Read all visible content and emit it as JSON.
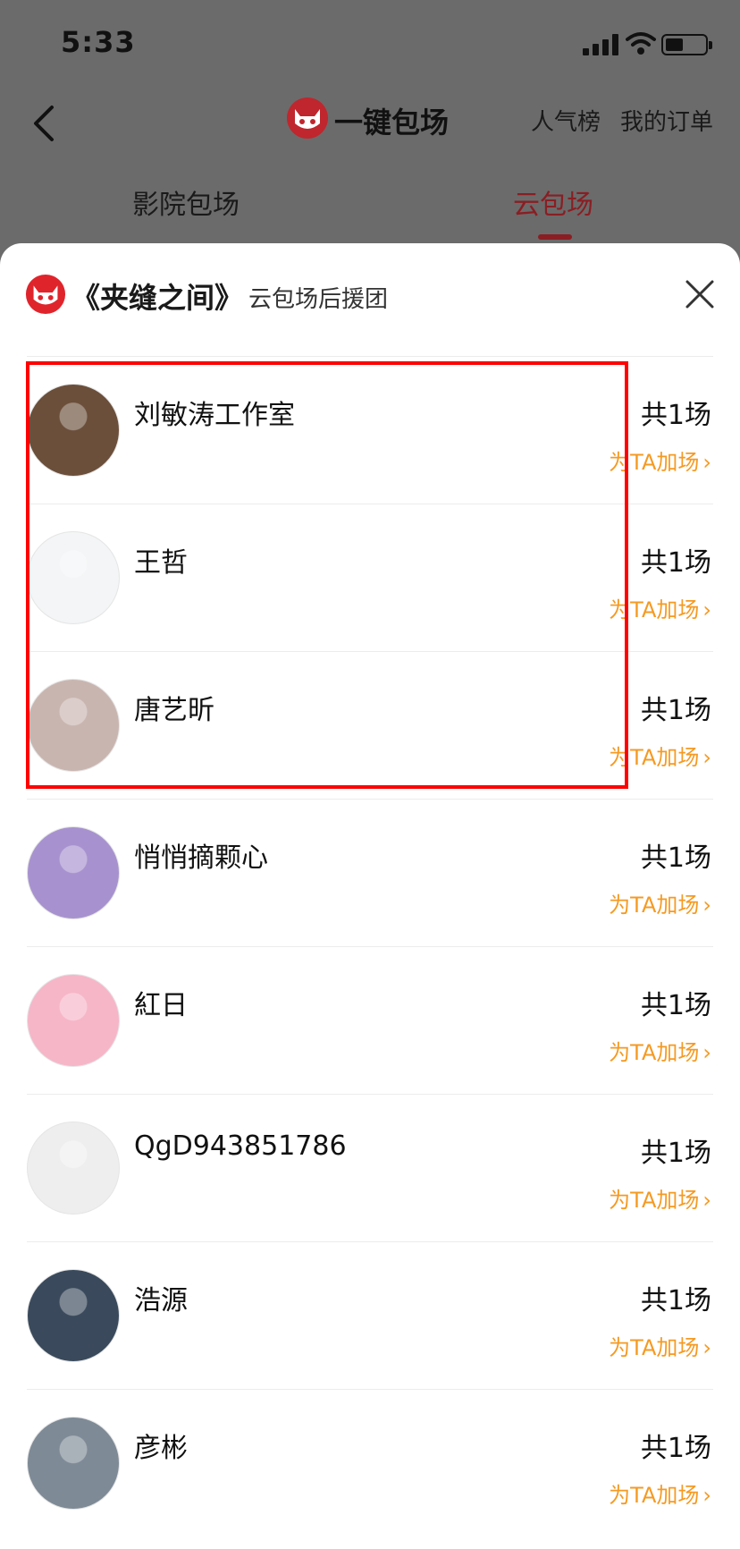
{
  "status_bar": {
    "time": "5:33",
    "battery_level": 0.45
  },
  "nav": {
    "title": "一键包场",
    "rank_label": "人气榜",
    "orders_label": "我的订单"
  },
  "tabs": [
    {
      "label": "影院包场"
    },
    {
      "label": "云包场"
    }
  ],
  "sheet": {
    "movie_title": "《夹缝之间》",
    "subtitle": "云包场后援团"
  },
  "supporters": [
    {
      "name": "刘敏涛工作室",
      "count_label": "共1场",
      "action_label": "为TA加场",
      "avatar_color": "#6b4f3b"
    },
    {
      "name": "王哲",
      "count_label": "共1场",
      "action_label": "为TA加场",
      "avatar_color": "#f3f5f6"
    },
    {
      "name": "唐艺昕",
      "count_label": "共1场",
      "action_label": "为TA加场",
      "avatar_color": "#c9b5b0"
    },
    {
      "name": "悄悄摘颗心",
      "count_label": "共1场",
      "action_label": "为TA加场",
      "avatar_color": "#a792cf"
    },
    {
      "name": "紅日",
      "count_label": "共1场",
      "action_label": "为TA加场",
      "avatar_color": "#f6b6c8"
    },
    {
      "name": "QgD943851786",
      "count_label": "共1场",
      "action_label": "为TA加场",
      "avatar_color": "#eeeeee"
    },
    {
      "name": "浩源",
      "count_label": "共1场",
      "action_label": "为TA加场",
      "avatar_color": "#3a4a5c"
    },
    {
      "name": "彦彬",
      "count_label": "共1场",
      "action_label": "为TA加场",
      "avatar_color": "#7e8a96"
    }
  ],
  "colors": {
    "accent": "#8a1e23",
    "action": "#f59a23",
    "highlight": "#ff0000"
  },
  "icons": [
    "back-icon",
    "maoyan-cat-icon",
    "close-icon",
    "chevron-right-icon",
    "wifi-icon",
    "signal-icon",
    "battery-icon"
  ]
}
